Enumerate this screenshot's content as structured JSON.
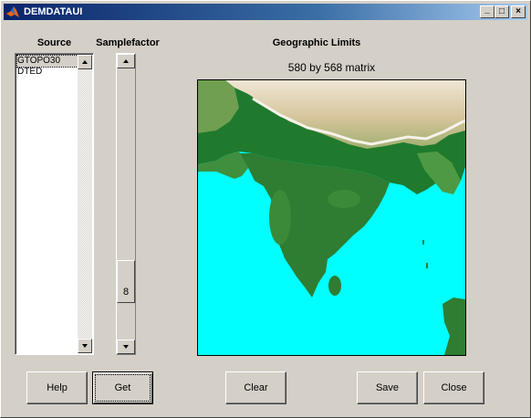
{
  "window": {
    "title": "DEMDATAUI",
    "minimize": "_",
    "maximize": "□",
    "close": "×"
  },
  "labels": {
    "source": "Source",
    "samplefactor": "Samplefactor",
    "geographic_limits": "Geographic Limits"
  },
  "source_list": {
    "items": [
      "GTOPO30",
      "DTED"
    ],
    "selected": "GTOPO30"
  },
  "samplefactor": {
    "value": "8",
    "level": 0.84
  },
  "matrix_info": "580 by 568 matrix",
  "map": {
    "colors": {
      "ocean": "#00ffff",
      "lowland": "#2e7d32",
      "upland": "#6aa84f",
      "mountain": "#d8c8a0",
      "peak": "#f4f0e8"
    }
  },
  "buttons": {
    "help": "Help",
    "get": "Get",
    "clear": "Clear",
    "save": "Save",
    "close": "Close"
  }
}
